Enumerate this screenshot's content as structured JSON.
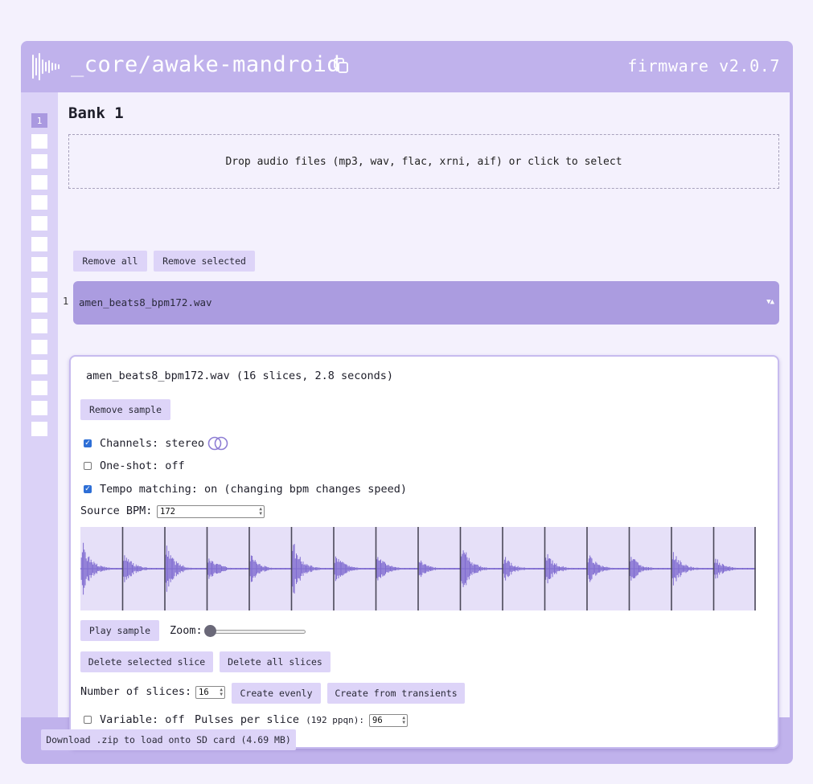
{
  "header": {
    "title": "_core/awake-mandroid",
    "firmware": "firmware v2.0.7",
    "logo_icon": "waveform-icon",
    "copy_icon": "copy-icon"
  },
  "banks": {
    "items": [
      "1",
      "",
      "",
      "",
      "",
      "",
      "",
      "",
      "",
      "",
      "",
      "",
      "",
      "",
      "",
      ""
    ],
    "active_index": 0
  },
  "bank": {
    "title": "Bank 1",
    "dropzone_text": "Drop audio files (mp3, wav, flac, xrni, aif) or click to select",
    "remove_all": "Remove all",
    "remove_selected": "Remove selected"
  },
  "sample_list": [
    {
      "index": "1",
      "name": "amen_beats8_bpm172.wav",
      "sort_icon": "▼▲"
    }
  ],
  "detail": {
    "title": "amen_beats8_bpm172.wav (16 slices, 2.8 seconds)",
    "remove_sample": "Remove sample",
    "channels_label": "Channels: stereo",
    "channels_checked": true,
    "oneshot_label": "One-shot: off",
    "oneshot_checked": false,
    "tempo_label": "Tempo matching: on (changing bpm changes speed)",
    "tempo_checked": true,
    "source_bpm_label": "Source BPM:",
    "source_bpm_value": "172",
    "slice_count": 16,
    "play_sample": "Play sample",
    "zoom_label": "Zoom:",
    "zoom_level": 0,
    "delete_selected_slice": "Delete selected slice",
    "delete_all_slices": "Delete all slices",
    "num_slices_label": "Number of slices:",
    "num_slices_value": "16",
    "create_evenly": "Create evenly",
    "create_transients": "Create from transients",
    "variable_label": "Variable: off",
    "variable_checked": false,
    "pulses_label": "Pulses per slice",
    "pulses_sub": "(192 ppqn):",
    "pulses_value": "96"
  },
  "footer": {
    "download": "Download .zip to load onto SD card (4.69 MB)"
  },
  "colors": {
    "accent": "#c0b2ec",
    "active_bank": "#aa99e0",
    "wave": "#7f6bd0",
    "button": "#ddd4f8"
  }
}
